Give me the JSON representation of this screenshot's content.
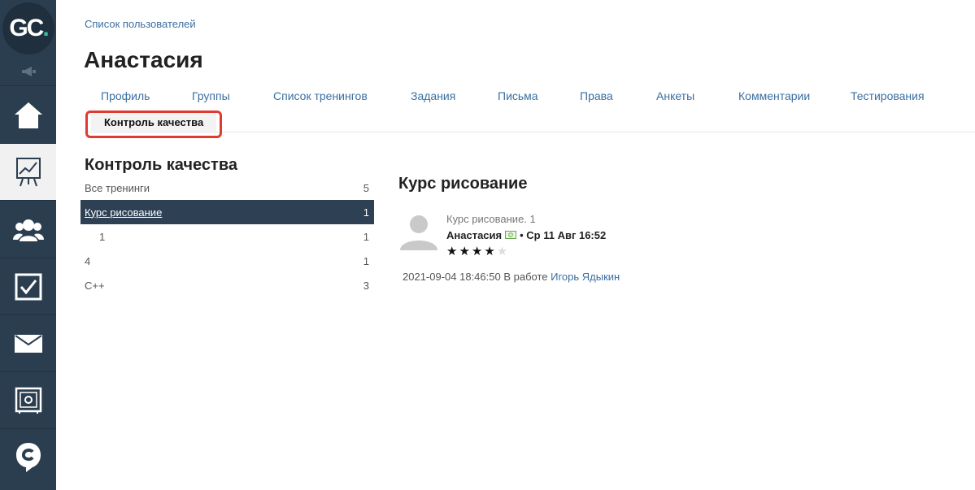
{
  "logo": {
    "text": "GC",
    "dot": "."
  },
  "breadcrumb": "Список пользователей",
  "title": "Анастасия",
  "tabs": [
    "Профиль",
    "Группы",
    "Список тренингов",
    "Задания",
    "Письма",
    "Права",
    "Анкеты",
    "Комментарии",
    "Тестирования"
  ],
  "active_tab": "Контроль качества",
  "section_title": "Контроль качества",
  "list": [
    {
      "label": "Все тренинги",
      "count": "5"
    },
    {
      "label": "Курс рисование",
      "count": "1"
    },
    {
      "label": "1",
      "count": "1"
    },
    {
      "label": "4",
      "count": "1"
    },
    {
      "label": "C++",
      "count": "3"
    }
  ],
  "detail": {
    "title": "Курс рисование",
    "meta_line": "Курс рисование. 1",
    "author": "Анастасия",
    "date": "• Ср 11 Авг 16:52",
    "rating": 4,
    "rating_max": 5,
    "status_prefix": "2021-09-04 18:46:50 В работе",
    "status_user": "Игорь Ядыкин"
  },
  "colors": {
    "sidebar": "#2b3e50",
    "link": "#3b6fa0",
    "highlight": "#e03b31",
    "selected_row": "#2e4154"
  },
  "icons": [
    "megaphone-icon",
    "home-icon",
    "chart-icon",
    "users-icon",
    "checkbox-icon",
    "mail-icon",
    "safe-icon",
    "chat-icon"
  ]
}
